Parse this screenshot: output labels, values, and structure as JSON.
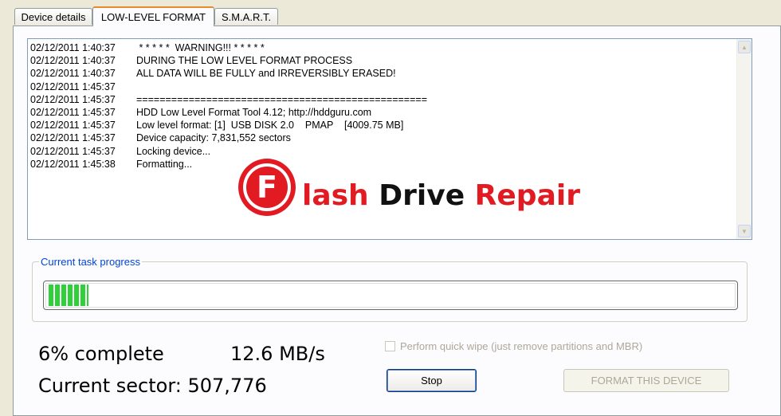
{
  "tabs": [
    {
      "label": "Device details",
      "active": false
    },
    {
      "label": "LOW-LEVEL FORMAT",
      "active": true
    },
    {
      "label": "S.M.A.R.T.",
      "active": false
    }
  ],
  "log": [
    {
      "time": "02/12/2011 1:40:37",
      "text": " * * * * *  WARNING!!! * * * * *"
    },
    {
      "time": "02/12/2011 1:40:37",
      "text": "DURING THE LOW LEVEL FORMAT PROCESS"
    },
    {
      "time": "02/12/2011 1:40:37",
      "text": "ALL DATA WILL BE FULLY and IRREVERSIBLY ERASED!"
    },
    {
      "time": "02/12/2011 1:45:37",
      "text": ""
    },
    {
      "time": "02/12/2011 1:45:37",
      "text": "=================================================="
    },
    {
      "time": "02/12/2011 1:45:37",
      "text": "HDD Low Level Format Tool 4.12; http://hddguru.com"
    },
    {
      "time": "02/12/2011 1:45:37",
      "text": "Low level format: [1]  USB DISK 2.0    PMAP    [4009.75 MB]"
    },
    {
      "time": "02/12/2011 1:45:37",
      "text": "Device capacity: 7,831,552 sectors"
    },
    {
      "time": "02/12/2011 1:45:37",
      "text": "Locking device..."
    },
    {
      "time": "02/12/2011 1:45:38",
      "text": "Formatting..."
    }
  ],
  "watermark": {
    "letter": "F",
    "part1": "lash",
    "part2": "Drive",
    "part3": "Repair",
    "colors": {
      "red": "#e21b23",
      "black": "#111111"
    }
  },
  "progress": {
    "group_label": "Current task progress",
    "percent": 6,
    "color": "#2fd03a"
  },
  "stats": {
    "complete": "6% complete",
    "speed": "12.6 MB/s",
    "sector": "Current sector: 507,776"
  },
  "options": {
    "quick_wipe_label": "Perform quick wipe (just remove partitions and MBR)",
    "quick_wipe_checked": false
  },
  "buttons": {
    "stop": "Stop",
    "format": "FORMAT THIS DEVICE"
  }
}
